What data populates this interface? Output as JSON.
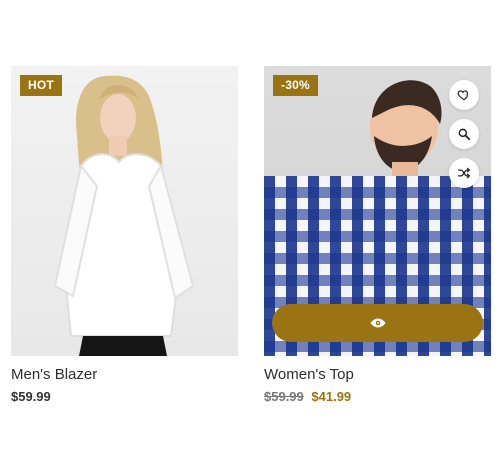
{
  "products": [
    {
      "badge": "HOT",
      "title": "Men's Blazer",
      "price": "$59.99",
      "image_icon": "woman-white-blouse-photo"
    },
    {
      "badge": "-30%",
      "title": "Women's Top",
      "old_price": "$59.99",
      "sale_price": "$41.99",
      "image_icon": "man-checked-shirt-photo",
      "actions": [
        "heart-icon",
        "search-icon",
        "shuffle-icon"
      ],
      "quickview_icon": "eye-icon"
    }
  ],
  "colors": {
    "accent": "#9a7412",
    "text": "#2d2d2d",
    "muted": "#777777",
    "shirt_blue": "#1a348e"
  }
}
